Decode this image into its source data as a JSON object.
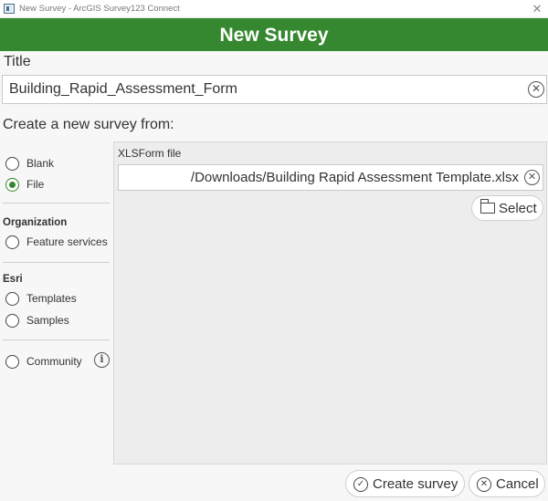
{
  "window": {
    "title": "New Survey - ArcGIS Survey123 Connect",
    "close_glyph": "✕",
    "app_icon": "survey123-app-icon"
  },
  "header": {
    "title": "New Survey",
    "background_color": "#35882f"
  },
  "title_field": {
    "label": "Title",
    "value": "Building_Rapid_Assessment_Form",
    "clear_glyph": "✕"
  },
  "create_from": {
    "label": "Create a new survey from:",
    "options": {
      "blank": "Blank",
      "file": "File",
      "feature_services": "Feature services",
      "templates": "Templates",
      "samples": "Samples",
      "community": "Community"
    },
    "selected": "File",
    "sections": {
      "organization": "Organization",
      "esri": "Esri"
    },
    "info_glyph": "i"
  },
  "xlsform": {
    "label": "XLSForm file",
    "value": "/Downloads/Building Rapid Assessment Template.xlsx",
    "clear_glyph": "✕",
    "select_label": "Select"
  },
  "actions": {
    "create_label": "Create survey",
    "create_glyph": "✓",
    "cancel_label": "Cancel",
    "cancel_glyph": "✕"
  }
}
